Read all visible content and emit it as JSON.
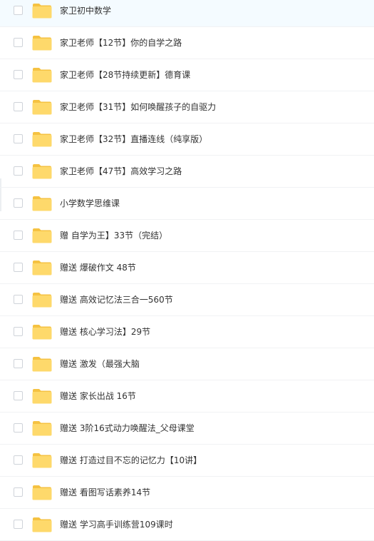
{
  "colors": {
    "folder_body": "#fed96b",
    "folder_tab": "#f5c242",
    "row_divider": "#f1f2f4",
    "text": "#333333",
    "checkbox_border": "#cfd3d9"
  },
  "file_list": {
    "items": [
      {
        "name": "家卫初中数学",
        "icon": "folder-icon"
      },
      {
        "name": "家卫老师【12节】你的自学之路",
        "icon": "folder-icon"
      },
      {
        "name": "家卫老师【28节持续更新】德育课",
        "icon": "folder-icon"
      },
      {
        "name": "家卫老师【31节】如何唤醒孩子的自驱力",
        "icon": "folder-icon"
      },
      {
        "name": "家卫老师【32节】直播连线（纯享版）",
        "icon": "folder-icon"
      },
      {
        "name": "家卫老师【47节】高效学习之路",
        "icon": "folder-icon"
      },
      {
        "name": "小学数学思维课",
        "icon": "folder-icon"
      },
      {
        "name": "赠 自学为王】33节（完结）",
        "icon": "folder-icon"
      },
      {
        "name": "赠送 爆破作文 48节",
        "icon": "folder-icon"
      },
      {
        "name": "赠送 高效记忆法三合一560节",
        "icon": "folder-icon"
      },
      {
        "name": "赠送 核心学习法】29节",
        "icon": "folder-icon"
      },
      {
        "name": "赠送 激发（最强大脑",
        "icon": "folder-icon"
      },
      {
        "name": "赠送 家长出战 16节",
        "icon": "folder-icon"
      },
      {
        "name": "赠送 3阶16式动力唤醒法_父母课堂",
        "icon": "folder-icon"
      },
      {
        "name": "赠送 打造过目不忘的记忆力【10讲】",
        "icon": "folder-icon"
      },
      {
        "name": "赠送 看图写话素养14节",
        "icon": "folder-icon"
      },
      {
        "name": "赠送 学习高手训练营109课时",
        "icon": "folder-icon"
      }
    ]
  }
}
